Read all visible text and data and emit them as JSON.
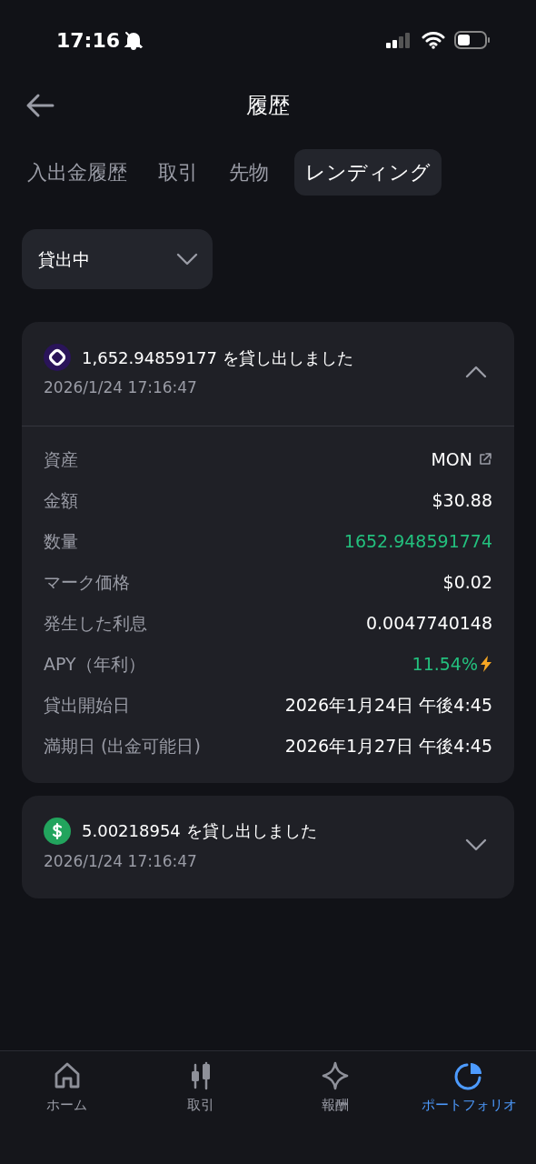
{
  "status_bar": {
    "time": "17:16"
  },
  "header": {
    "title": "履歴"
  },
  "tabs": [
    {
      "label": "入出金履歴",
      "selected": false
    },
    {
      "label": "取引",
      "selected": false
    },
    {
      "label": "先物",
      "selected": false
    },
    {
      "label": "レンディング",
      "selected": true
    }
  ],
  "filter": {
    "value": "貸出中"
  },
  "loans": [
    {
      "kind": "mon",
      "title": "1,652.94859177 を貸し出しました",
      "time": "2026/1/24 17:16:47",
      "expanded": true,
      "details": [
        {
          "label": "資産",
          "value": "MON",
          "kind": "link"
        },
        {
          "label": "金額",
          "value": "$30.88",
          "kind": "plain"
        },
        {
          "label": "数量",
          "value": "1652.948591774",
          "kind": "positive"
        },
        {
          "label": "マーク価格",
          "value": "$0.02",
          "kind": "plain"
        },
        {
          "label": "発生した利息",
          "value": "0.0047740148",
          "kind": "plain"
        },
        {
          "label": "APY（年利）",
          "value": "11.54%",
          "kind": "boost"
        },
        {
          "label": "貸出開始日",
          "value": "2026年1月24日 午後4:45",
          "kind": "plain"
        },
        {
          "label": "満期日 (出金可能日)",
          "value": "2026年1月27日 午後4:45",
          "kind": "plain"
        }
      ]
    },
    {
      "kind": "usd",
      "title": "5.00218954 を貸し出しました",
      "time": "2026/1/24 17:16:47",
      "expanded": false
    }
  ],
  "bottom_nav": [
    {
      "kind": "home",
      "label": "ホーム",
      "selected": false
    },
    {
      "kind": "candles",
      "label": "取引",
      "selected": false
    },
    {
      "kind": "sparkle",
      "label": "報酬",
      "selected": false
    },
    {
      "kind": "pie",
      "label": "ポートフォリオ",
      "selected": true
    }
  ]
}
